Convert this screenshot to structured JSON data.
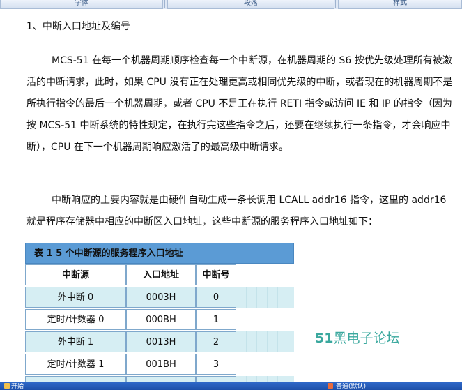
{
  "ribbon": {
    "groups": [
      "字体",
      "段落",
      "样式"
    ]
  },
  "taskbar": {
    "items": [
      "开始",
      "普通(默认)"
    ]
  },
  "doc": {
    "heading": "1、中断入口地址及编号",
    "para1": "MCS-51 在每一个机器周期顺序检查每一个中断源，在机器周期的 S6 按优先级处理所有被激活的中断请求，此时，如果 CPU 没有正在处理更高或相同优先级的中断，或者现在的机器周期不是所执行指令的最后一个机器周期，或者 CPU 不是正在执行 RETI 指令或访问 IE 和 IP 的指令（因为按 MCS-51 中断系统的特性规定，在执行完这些指令之后，还要在继续执行一条指令，才会响应中断），CPU 在下一个机器周期响应激活了的最高级中断请求。",
    "para2": "中断响应的主要内容就是由硬件自动生成一条长调用 LCALL  addr16 指令，这里的 addr16 就是程序存储器中相应的中断区入口地址，这些中断源的服务程序入口地址如下："
  },
  "table": {
    "caption": "表 1   5 个中断源的服务程序入口地址",
    "headers": [
      "中断源",
      "入口地址",
      "中断号"
    ],
    "rows": [
      [
        "外中断 0",
        "0003H",
        "0"
      ],
      [
        "定时/计数器 0",
        "000BH",
        "1"
      ],
      [
        "外中断 1",
        "0013H",
        "2"
      ],
      [
        "定时/计数器 1",
        "001BH",
        "3"
      ]
    ]
  },
  "watermark": {
    "number": "51",
    "text": "黑电子论坛"
  }
}
